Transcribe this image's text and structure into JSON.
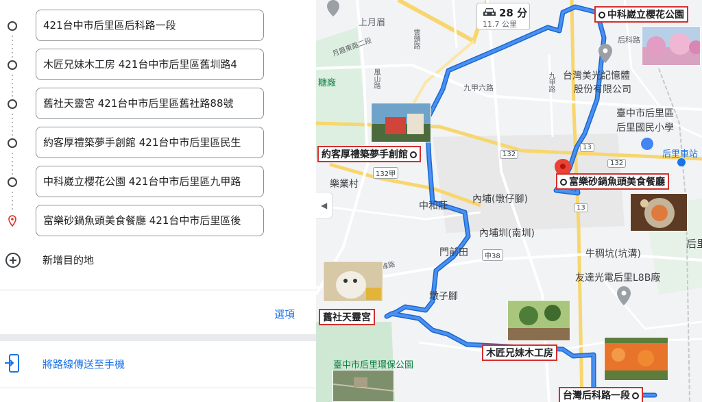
{
  "stops": [
    {
      "text": "421台中市后里區后科路一段",
      "icon": "circle-icon"
    },
    {
      "text": "木匠兄妹木工房 421台中市后里區舊圳路4",
      "icon": "circle-icon"
    },
    {
      "text": "舊社天靈宮 421台中市后里區舊社路88號",
      "icon": "circle-icon"
    },
    {
      "text": "約客厚禮築夢手創館 421台中市后里區民生",
      "icon": "circle-icon"
    },
    {
      "text": "中科崴立櫻花公園 421台中市后里區九甲路",
      "icon": "circle-icon"
    },
    {
      "text": "富樂砂鍋魚頭美食餐廳 421台中市后里區後",
      "icon": "red-pin-icon"
    }
  ],
  "add_destination": "新增目的地",
  "options": "選項",
  "send_to_phone": "將路線傳送至手機",
  "travel": {
    "time": "28 分",
    "distance": "11.7 公里"
  },
  "callouts": {
    "sakura": "中科崴立櫻花公園",
    "yueke": "約客厚禮築夢手創館",
    "fule": "富樂砂鍋魚頭美食餐廳",
    "tianling": "舊社天靈宮",
    "mujiang": "木匠兄妹木工房",
    "hoke": "台灣后科路一段"
  },
  "map_labels": {
    "shangyuemei": "上月眉",
    "houkeroad": "后科路",
    "meilihall1": "台灣美光記憶體",
    "meilihall2": "股份有限公司",
    "school1": "臺中市后里區",
    "school2": "后里國民小學",
    "station": "后里車站",
    "tanghang": "糖廠",
    "jiujiarow": "九甲六路",
    "yuemeiroad": "月眉東路二段",
    "fengshan": "風山路",
    "yunqiao": "雲頭路",
    "jiujialu": "九甲路",
    "leye": "樂業村",
    "zhonghe": "中和莊",
    "neibu": "內埔(墩仔腳)",
    "neibunan": "內埔圳(南圳)",
    "menqiantian": "門前田",
    "niucoukeng": "牛稠坑(坑溝)",
    "duizijiao": "墩子腳",
    "solar": "友達光電后里L8B廠",
    "park": "臺中市后里環保公園",
    "sanjiao": "三線路",
    "houright": "后里"
  },
  "road_signs": {
    "r132a": "132",
    "r132b": "132",
    "r132c": "132甲",
    "r13a": "13",
    "r13b": "13",
    "r13c": "13",
    "r38": "中38"
  },
  "colors": {
    "route": "#4285f4",
    "route_border": "#1967d2",
    "callout_border": "#d32f2f",
    "link": "#1a73e8"
  }
}
